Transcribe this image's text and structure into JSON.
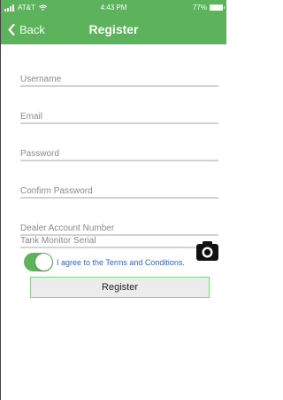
{
  "status_bar": {
    "carrier": "AT&T",
    "time": "4:43 PM",
    "battery": "77%"
  },
  "nav": {
    "back_label": "Back",
    "title": "Register"
  },
  "form": {
    "username_placeholder": "Username",
    "email_placeholder": "Email",
    "password_placeholder": "Password",
    "confirm_password_placeholder": "Confirm Password",
    "dealer_account_placeholder": "Dealer Account Number",
    "tank_monitor_placeholder": "Tank Monitor Serial"
  },
  "terms": {
    "label": "I agree to the Terms and Conditions.",
    "accepted": true
  },
  "register_button_label": "Register",
  "colors": {
    "brand_green": "#5cb35c",
    "link_blue": "#3a66c4",
    "field_underline": "#d3d3d3"
  },
  "icons": {
    "back": "chevron-left-icon",
    "camera": "camera-icon",
    "signal": "cellular-signal-icon",
    "wifi": "wifi-icon",
    "battery": "battery-icon"
  }
}
